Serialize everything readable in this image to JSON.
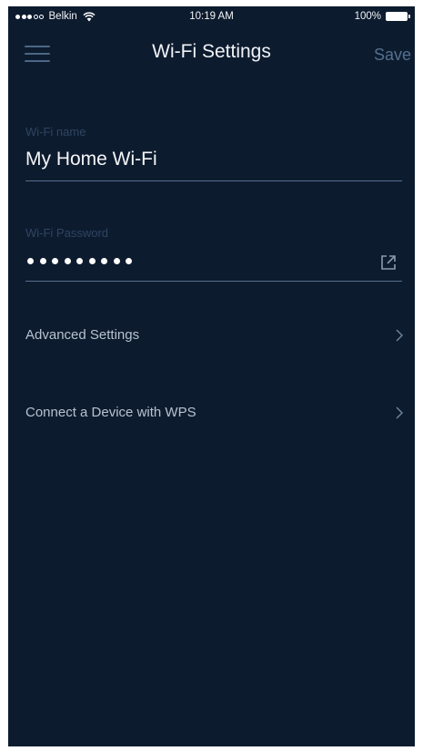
{
  "status_bar": {
    "carrier": "Belkin",
    "time": "10:19 AM",
    "battery": "100%"
  },
  "header": {
    "title": "Wi-Fi Settings",
    "save_label": "Save"
  },
  "wifi_name": {
    "label": "Wi-Fi name",
    "value": "My Home Wi-Fi"
  },
  "wifi_password": {
    "label": "Wi-Fi Password",
    "masked_char_count": 9
  },
  "rows": [
    {
      "label": "Advanced Settings"
    },
    {
      "label": "Connect a Device with WPS"
    }
  ],
  "colors": {
    "background": "#0d1b2e",
    "text_primary": "#f0f3f7",
    "text_secondary": "#b6c2d0",
    "label_dim": "#2e4561",
    "accent_muted": "#53708f"
  },
  "icons": {
    "menu": "hamburger-menu-icon",
    "share": "share-icon",
    "chevron": "chevron-right-icon",
    "wifi": "wifi-signal-icon",
    "battery": "battery-icon"
  }
}
